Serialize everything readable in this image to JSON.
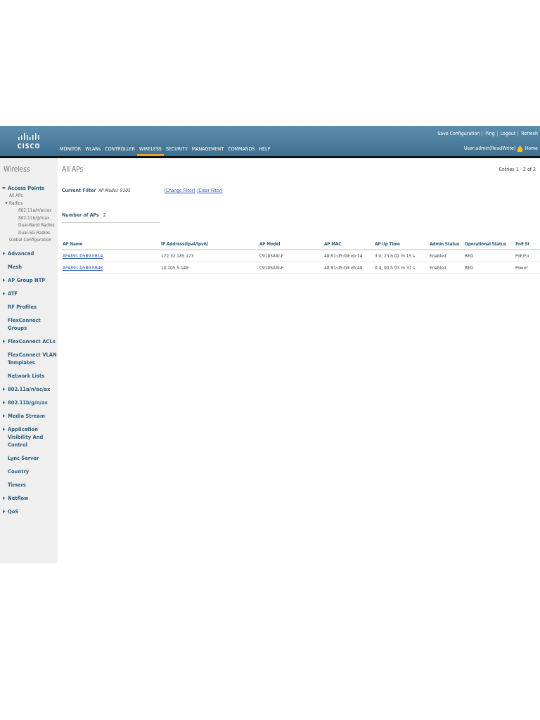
{
  "header": {
    "logo": "CISCO",
    "nav": [
      {
        "label": "MONITOR",
        "selected": false
      },
      {
        "label": "WLANs",
        "selected": false
      },
      {
        "label": "CONTROLLER",
        "selected": false
      },
      {
        "label": "WIRELESS",
        "selected": true
      },
      {
        "label": "SECURITY",
        "selected": false
      },
      {
        "label": "MANAGEMENT",
        "selected": false
      },
      {
        "label": "COMMANDS",
        "selected": false
      },
      {
        "label": "HELP",
        "selected": false
      }
    ],
    "top_links": [
      "Save Configuration",
      "Ping",
      "Logout",
      "Refresh"
    ],
    "user": "User:admin(ReadWrite)",
    "home": "Home"
  },
  "sidebar": {
    "title": "Wireless",
    "items": [
      {
        "label": "Access Points",
        "kind": "group",
        "expanded": true,
        "children": [
          {
            "label": "All APs"
          },
          {
            "label": "Radios",
            "expanded": true,
            "children": [
              {
                "label": "802.11a/n/ac/ax"
              },
              {
                "label": "802.11b/g/n/ax"
              },
              {
                "label": "Dual-Band Radios"
              },
              {
                "label": "Dual-5G Radios"
              }
            ]
          },
          {
            "label": "Global Configuration"
          }
        ]
      },
      {
        "label": "Advanced",
        "kind": "group",
        "expanded": false
      },
      {
        "label": "Mesh",
        "kind": "link"
      },
      {
        "label": "AP Group NTP",
        "kind": "group",
        "expanded": false
      },
      {
        "label": "ATF",
        "kind": "group",
        "expanded": false
      },
      {
        "label": "RF Profiles",
        "kind": "link"
      },
      {
        "label": "FlexConnect Groups",
        "kind": "link"
      },
      {
        "label": "FlexConnect ACLs",
        "kind": "group",
        "expanded": false
      },
      {
        "label": "FlexConnect VLAN Templates",
        "kind": "link"
      },
      {
        "label": "Network Lists",
        "kind": "link"
      },
      {
        "label": "802.11a/n/ac/ax",
        "kind": "group",
        "expanded": false
      },
      {
        "label": "802.11b/g/n/ax",
        "kind": "group",
        "expanded": false
      },
      {
        "label": "Media Stream",
        "kind": "group",
        "expanded": false
      },
      {
        "label": "Application Visibility And Control",
        "kind": "group",
        "expanded": false
      },
      {
        "label": "Lync Server",
        "kind": "link"
      },
      {
        "label": "Country",
        "kind": "link"
      },
      {
        "label": "Timers",
        "kind": "link"
      },
      {
        "label": "Netflow",
        "kind": "group",
        "expanded": false
      },
      {
        "label": "QoS",
        "kind": "group",
        "expanded": false
      }
    ]
  },
  "main": {
    "title": "All APs",
    "entries": "Entries 1 - 2 of 2",
    "filter": {
      "label": "Current Filter",
      "value": "AP Model: 9105",
      "links": [
        "[Change Filter]",
        "[Clear Filter]"
      ]
    },
    "count": {
      "label": "Number of APs",
      "value": "2"
    },
    "table": {
      "columns": [
        "AP Name",
        "IP Address(Ipv4/Ipv6)",
        "AP Model",
        "AP MAC",
        "AP Up Time",
        "Admin Status",
        "Operational Status",
        "PoE St"
      ],
      "rows": [
        [
          "AP4891.D5B9.EB14",
          "172.32.185.173",
          "C9105AXI-F",
          "48:91:d5:b9:eb:14",
          "3 d, 23 h 02 m 15 s",
          "Enabled",
          "REG",
          "PoE/Fu"
        ],
        [
          "AP4891.D5B9.EB48",
          "10.105.5.149",
          "C9105AXI-F",
          "48:91:d5:b9:eb:48",
          "0 d, 00 h 03 m 31 s",
          "Enabled",
          "REG",
          "Power"
        ]
      ]
    }
  }
}
